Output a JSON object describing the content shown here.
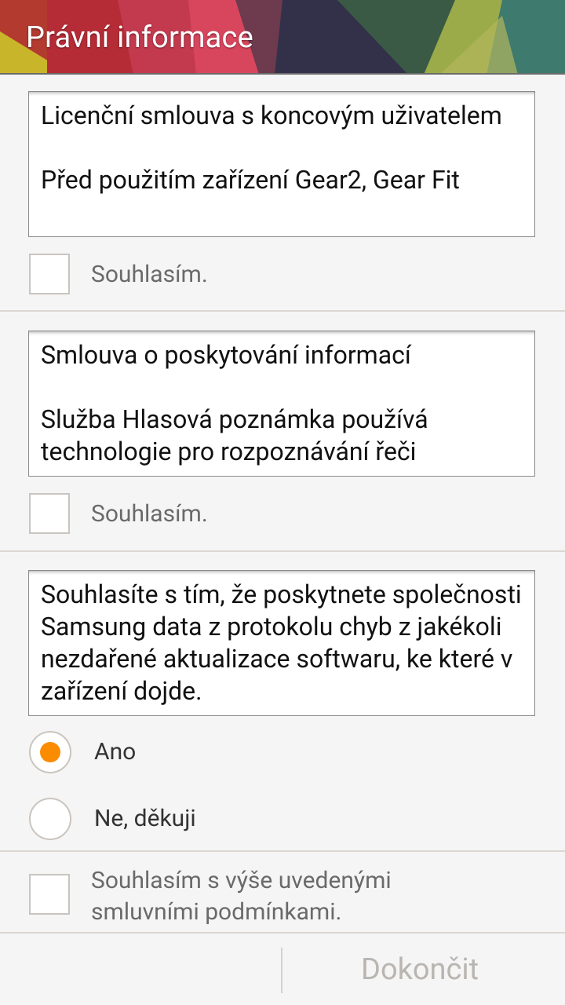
{
  "header": {
    "title": "Právní informace"
  },
  "sections": {
    "eula": {
      "heading": "Licenční smlouva s koncovým uživatelem",
      "body": "Před použitím zařízení Gear2, Gear Fit",
      "agree_label": "Souhlasím."
    },
    "info": {
      "heading": "Smlouva o poskytování informací",
      "body": "Služba Hlasová poznámka používá technologie pro rozpoznávání řeči",
      "agree_label": "Souhlasím."
    },
    "error_log": {
      "text": "Souhlasíte s tím, že poskytnete společnosti Samsung data z protokolu chyb z jakékoli nezdařené aktualizace softwaru, ke které v zařízení dojde.",
      "options": [
        {
          "label": "Ano",
          "selected": true
        },
        {
          "label": "Ne, děkuji",
          "selected": false
        }
      ]
    },
    "final_agree": {
      "label": "Souhlasím s výše uvedenými smluvními podmínkami."
    }
  },
  "bottom_bar": {
    "finish_label": "Dokončit"
  },
  "colors": {
    "radio_selected": "#fb8c00",
    "accent_header": "#c8384b"
  }
}
